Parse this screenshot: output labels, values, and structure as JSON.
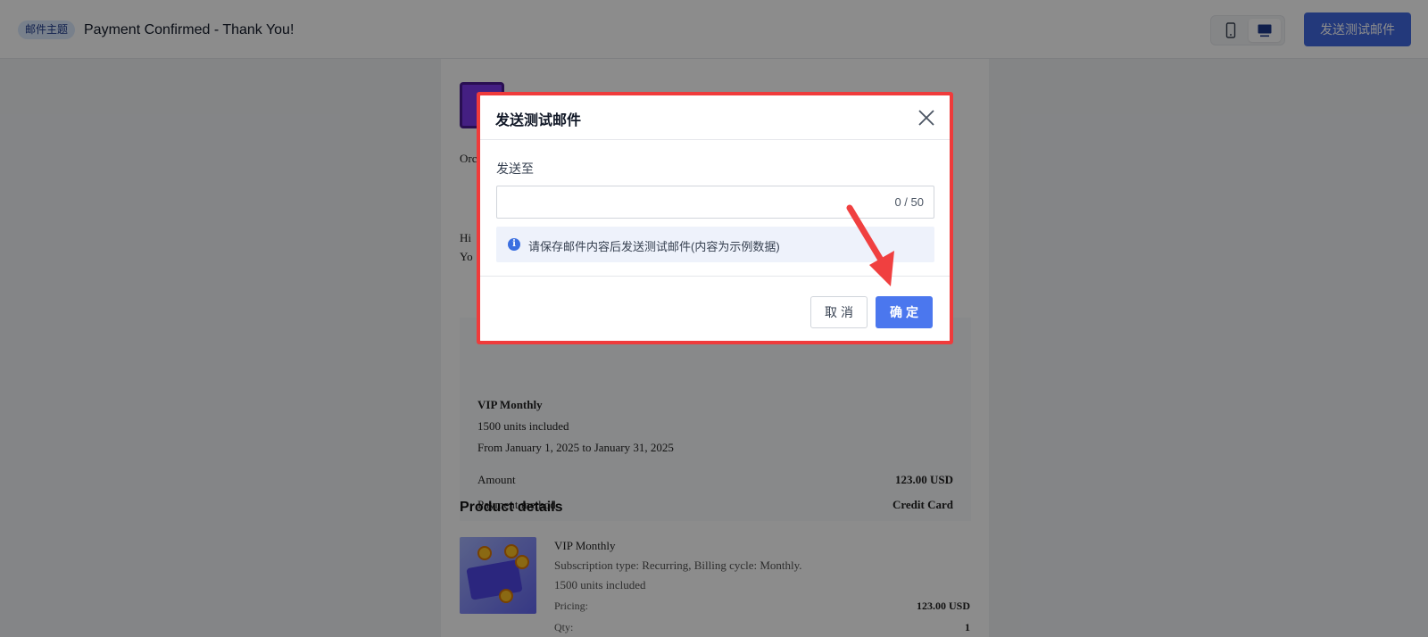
{
  "header": {
    "subject_tag": "邮件主题",
    "subject_text": "Payment Confirmed - Thank You!",
    "device_modes": [
      "mobile",
      "desktop"
    ],
    "active_device": "desktop",
    "send_test_label": "发送测试邮件"
  },
  "email": {
    "order_line": "Orc",
    "hi_line": "Hi",
    "you_line": "Yo",
    "summary": {
      "plan_name": "VIP Monthly",
      "units": "1500 units included",
      "period": "From January 1, 2025 to January 31, 2025",
      "rows": [
        {
          "label": "Amount",
          "value": "123.00 USD"
        },
        {
          "label": "Payment method",
          "value": "Credit Card"
        }
      ]
    },
    "product_details": {
      "title": "Product details",
      "name": "VIP Monthly",
      "subscription": "Subscription type: Recurring, Billing cycle: Monthly.",
      "units": "1500 units included",
      "pricing_label": "Pricing:",
      "pricing_value": "123.00 USD",
      "qty_label": "Qty:",
      "qty_value": "1"
    }
  },
  "dialog": {
    "title": "发送测试邮件",
    "field_label": "发送至",
    "input_value": "",
    "counter": "0 / 50",
    "info_icon": "info-icon",
    "info_text": "请保存邮件内容后发送测试邮件(内容为示例数据)",
    "cancel_label": "取消",
    "confirm_label": "确定"
  },
  "colors": {
    "primary": "#4b77ee",
    "highlight": "#ef3b3b",
    "overlay": "rgba(0,0,0,0.45)"
  }
}
